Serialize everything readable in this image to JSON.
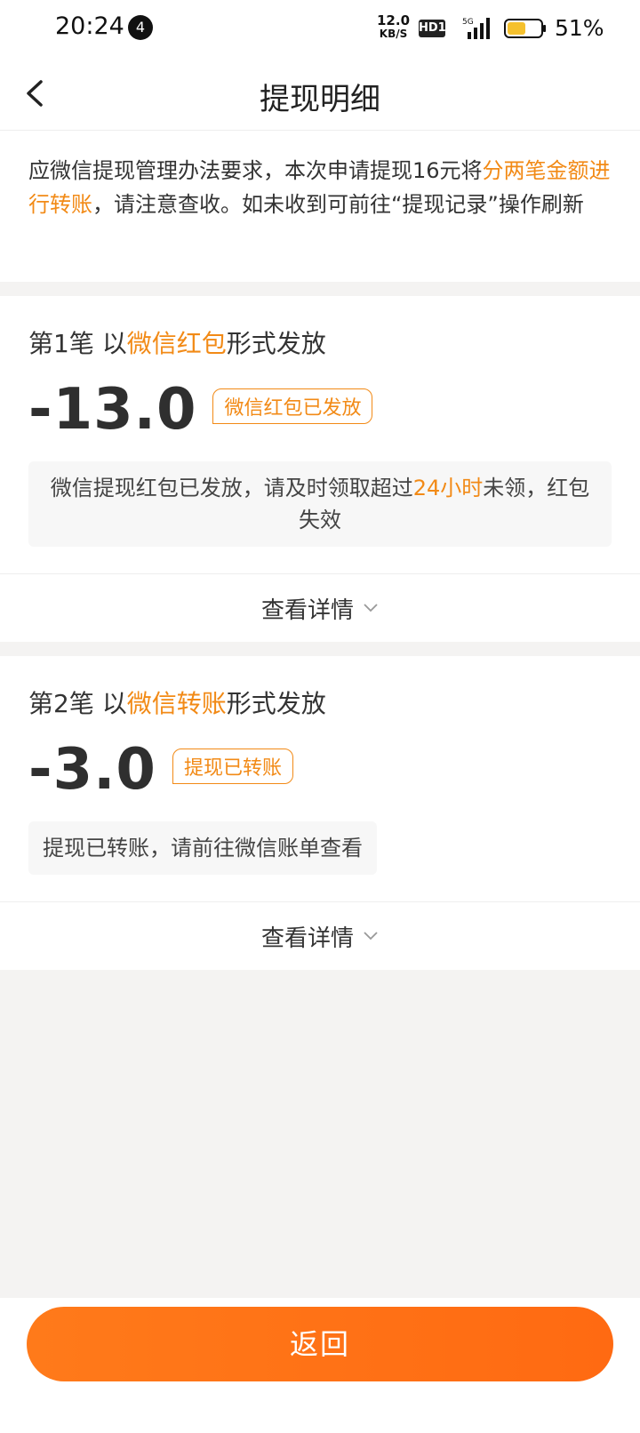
{
  "status_bar": {
    "time": "20:24",
    "notif_count": "4",
    "net_speed_value": "12.0",
    "net_speed_unit": "KB/S",
    "hd_label": "HD1",
    "network_label": "5G",
    "battery": "51%"
  },
  "nav": {
    "title": "提现明细"
  },
  "notice": {
    "part1": "应微信提现管理办法要求，本次申请提现16元将",
    "highlight": "分两笔金额进行转账",
    "part2": "，请注意查收。如未收到可前往“提现记录”操作刷新"
  },
  "payments": [
    {
      "head_prefix": "第1笔 以",
      "head_method": "微信红包",
      "head_suffix": "形式发放",
      "amount": "-13.0",
      "status": "微信红包已发放",
      "tip_part1": "微信提现红包已发放，请及时领取超过",
      "tip_highlight": "24小时",
      "tip_part2": "未领，红包失效",
      "detail_label": "查看详情"
    },
    {
      "head_prefix": "第2笔 以",
      "head_method": "微信转账",
      "head_suffix": "形式发放",
      "amount": "-3.0",
      "status": "提现已转账",
      "tip": "提现已转账，请前往微信账单查看",
      "detail_label": "查看详情"
    }
  ],
  "footer": {
    "return_label": "返回"
  },
  "colors": {
    "accent": "#f28a16",
    "button": "#ff7a1a"
  }
}
